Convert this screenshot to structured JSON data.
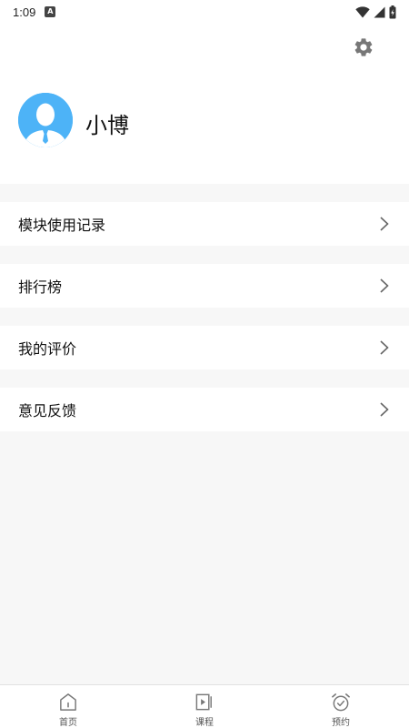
{
  "status_bar": {
    "time": "1:09",
    "notification_icon": "A"
  },
  "profile": {
    "username": "小博"
  },
  "menu": [
    {
      "label": "模块使用记录",
      "icon": "chevron-right-icon"
    },
    {
      "label": "排行榜",
      "icon": "chevron-right-icon"
    },
    {
      "label": "我的评价",
      "icon": "chevron-right-icon"
    },
    {
      "label": "意见反馈",
      "icon": "chevron-right-icon"
    }
  ],
  "tabs": [
    {
      "label": "首页",
      "icon": "home-icon"
    },
    {
      "label": "课程",
      "icon": "play-icon"
    },
    {
      "label": "预约",
      "icon": "alarm-clock-icon"
    }
  ],
  "colors": {
    "avatar_bg": "#4db3f7",
    "page_bg": "#f7f7f7",
    "icon_gray": "#777777"
  }
}
